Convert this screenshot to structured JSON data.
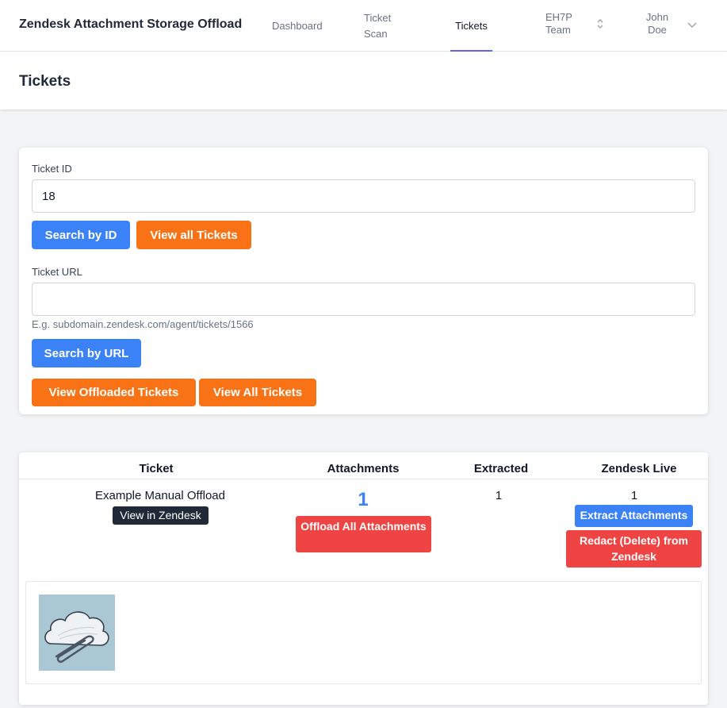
{
  "nav": {
    "brand": "Zendesk Attachment Storage Offload",
    "links": [
      "Dashboard",
      "Ticket Scan",
      "Tickets"
    ],
    "active": "Tickets",
    "team": "EH7P Team",
    "user": "John Doe"
  },
  "page": {
    "title": "Tickets"
  },
  "search": {
    "ticket_id_label": "Ticket ID",
    "ticket_id_value": "18",
    "search_by_id": "Search by ID",
    "view_all_tickets_1": "View all Tickets",
    "ticket_url_label": "Ticket URL",
    "ticket_url_value": "",
    "ticket_url_hint": "E.g. subdomain.zendesk.com/agent/tickets/1566",
    "search_by_url": "Search by URL",
    "view_offloaded": "View Offloaded Tickets",
    "view_all_tickets_2": "View All Tickets"
  },
  "results": {
    "headers": [
      "Ticket",
      "Attachments",
      "Extracted",
      "Zendesk Live"
    ],
    "row": {
      "ticket_name": "Example Manual Offload",
      "view_in_zendesk": "View in Zendesk",
      "attachments": "1",
      "offload_all": "Offload All Attachments",
      "extracted": "1",
      "zendesk_live": "1",
      "extract_attachments": "Extract Attachments",
      "redact": "Redact (Delete) from Zendesk"
    }
  },
  "colors": {
    "primary_blue": "#3b82f6",
    "orange": "#f97316",
    "red": "#ef4444",
    "active_tab_underline": "#6366f1"
  },
  "icons": {
    "team_chevron": "chevron-up-down-icon",
    "user_chevron": "chevron-down-icon",
    "thumbnail": "cloud-paperclip-icon"
  }
}
